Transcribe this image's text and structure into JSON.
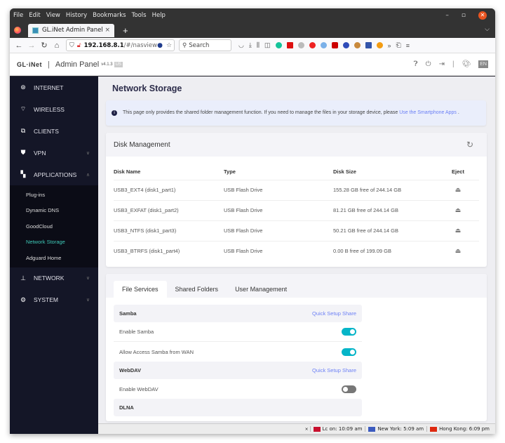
{
  "browser": {
    "menu": [
      "File",
      "Edit",
      "View",
      "History",
      "Bookmarks",
      "Tools",
      "Help"
    ],
    "tab_title": "GL.iNet Admin Panel",
    "url_host": "192.168.8.1",
    "url_path": "/#/nasview",
    "search_placeholder": "Search"
  },
  "header": {
    "logo": "GL·iNet",
    "title": "Admin Panel",
    "version": "v4.1.3",
    "region": "US",
    "language": "EN"
  },
  "sidebar": {
    "items": [
      {
        "label": "INTERNET",
        "icon": "globe-icon"
      },
      {
        "label": "WIRELESS",
        "icon": "wifi-icon"
      },
      {
        "label": "CLIENTS",
        "icon": "devices-icon"
      },
      {
        "label": "VPN",
        "icon": "shield-icon"
      },
      {
        "label": "APPLICATIONS",
        "icon": "grid-icon"
      },
      {
        "label": "NETWORK",
        "icon": "network-icon"
      },
      {
        "label": "SYSTEM",
        "icon": "gear-icon"
      }
    ],
    "subitems": [
      "Plug-ins",
      "Dynamic DNS",
      "GoodCloud",
      "Network Storage",
      "Adguard Home"
    ],
    "active_subitem": "Network Storage"
  },
  "main": {
    "page_title": "Network Storage",
    "alert_text": "This page only provides the shared folder management function. If you need to manage the files in your storage device, please ",
    "alert_link": "Use the Smartphone Apps",
    "alert_suffix": " .",
    "disk_card_title": "Disk Management",
    "disk_columns": [
      "Disk Name",
      "Type",
      "Disk Size",
      "Eject"
    ],
    "disks": [
      {
        "name": "USB3_EXT4 (disk1_part1)",
        "type": "USB Flash Drive",
        "size": "155.28 GB free of 244.14 GB"
      },
      {
        "name": "USB3_EXFAT (disk1_part2)",
        "type": "USB Flash Drive",
        "size": "81.21 GB free of 244.14 GB"
      },
      {
        "name": "USB3_NTFS (disk1_part3)",
        "type": "USB Flash Drive",
        "size": "50.21 GB free of 244.14 GB"
      },
      {
        "name": "USB3_BTRFS (disk1_part4)",
        "type": "USB Flash Drive",
        "size": "0.00 B free of 199.09 GB"
      }
    ],
    "tabs": [
      "File Services",
      "Shared Folders",
      "User Management"
    ],
    "active_tab": "File Services",
    "samba": {
      "title": "Samba",
      "link": "Quick Setup Share",
      "enable_label": "Enable Samba",
      "enable": true,
      "wan_label": "Allow Access Samba from WAN",
      "wan": true
    },
    "webdav": {
      "title": "WebDAV",
      "link": "Quick Setup Share",
      "enable_label": "Enable WebDAV",
      "enable": false
    },
    "dlna": {
      "title": "DLNA"
    }
  },
  "statusbar": {
    "clocks": [
      {
        "label": "Lc   on: 10:09 am",
        "color": "#c8102e"
      },
      {
        "label": "New York: 5:09 am",
        "color": "#3c5bbf"
      },
      {
        "label": "Hong Kong: 6:09 pm",
        "color": "#de2910"
      }
    ]
  }
}
